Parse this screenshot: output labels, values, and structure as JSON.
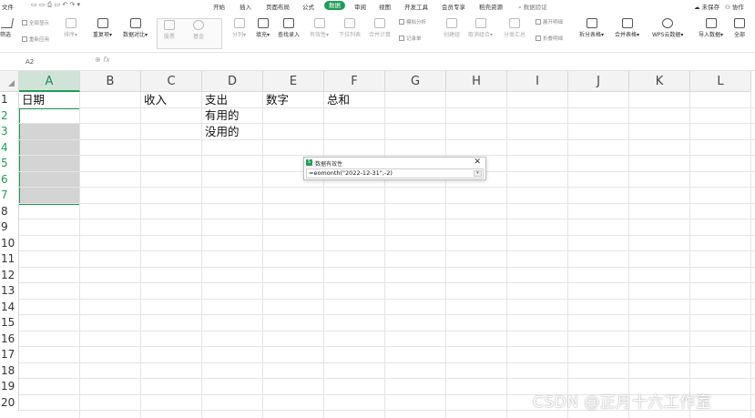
{
  "menubar": {
    "file": "文件",
    "tabs": [
      "开始",
      "插入",
      "页面布局",
      "公式",
      "数据",
      "审阅",
      "视图",
      "开发工具",
      "会员专享",
      "稻壳资源"
    ],
    "active_tab": "数据",
    "search": "数据验证",
    "right": [
      "未保存",
      "协作"
    ]
  },
  "ribbon": {
    "filter": "筛选",
    "show_all": "全部显示",
    "reapply": "重新应用",
    "sort": "排序",
    "duplicates": "重复项",
    "compare": "数据对比",
    "shares": "股票",
    "fund": "基金",
    "split": "分列",
    "fill": "填充",
    "lookup": "查找录入",
    "validity": "有效性",
    "dropdown": "下拉列表",
    "consolidate": "合并计算",
    "simulate": "模拟分析",
    "record": "记录单",
    "group": "创建组",
    "ungroup": "取消组合",
    "subtotal": "分类汇总",
    "expand": "展开明细",
    "collapse": "折叠明细",
    "split_table": "拆分表格",
    "merge_table": "合并表格",
    "wps_cloud": "WPS云数据",
    "import": "导入数据",
    "more": "全部"
  },
  "formula_bar": {
    "name_box": "A2",
    "fx": "fx"
  },
  "columns": [
    "A",
    "B",
    "C",
    "D",
    "E",
    "F",
    "G",
    "H",
    "I",
    "J",
    "K",
    "L"
  ],
  "rows": [
    "1",
    "2",
    "3",
    "4",
    "5",
    "6",
    "7",
    "8",
    "9",
    "10",
    "11",
    "12",
    "13",
    "14",
    "15",
    "16",
    "17",
    "18",
    "19",
    "20"
  ],
  "cells": {
    "A1": "日期",
    "C1": "收入",
    "D1": "支出",
    "E1": "数字",
    "F1": "总和",
    "D2": "有用的",
    "D3": "没用的"
  },
  "dialog": {
    "title": "数据有效性",
    "formula": "=eomonth(\"2022-12-31\",-2)"
  },
  "watermark": "CSDN @正月十六工作室",
  "colors": {
    "accent": "#1f9d55",
    "selection": "#d4d4d4"
  }
}
